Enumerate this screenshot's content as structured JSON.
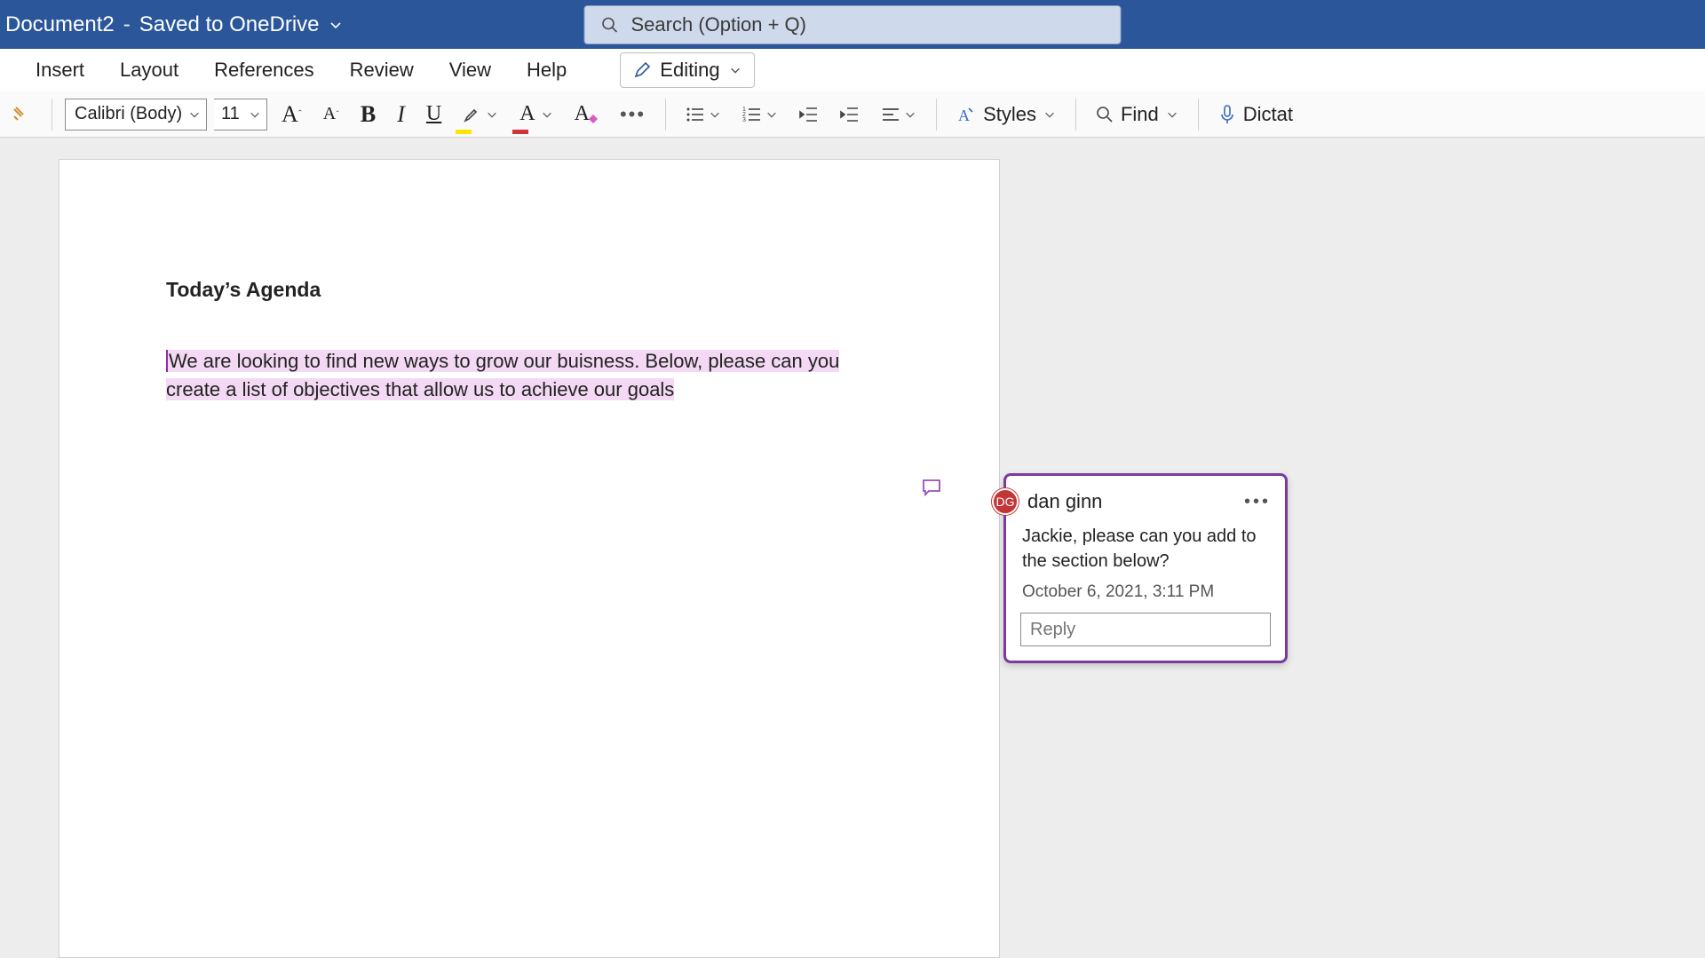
{
  "title": {
    "doc_name": "Document2",
    "save_status": "Saved to OneDrive"
  },
  "search": {
    "placeholder": "Search (Option + Q)"
  },
  "tabs": {
    "insert": "Insert",
    "layout": "Layout",
    "references": "References",
    "review": "Review",
    "view": "View",
    "help": "Help",
    "editing": "Editing"
  },
  "toolbar": {
    "font_name": "Calibri (Body)",
    "font_size": "11",
    "styles": "Styles",
    "find": "Find",
    "dictate": "Dictat"
  },
  "document": {
    "heading": "Today’s Agenda",
    "paragraph": "We are looking to find new ways to grow our buisness. Below, please can you create a list of objectives that allow us to achieve our goals"
  },
  "comment": {
    "initials": "DG",
    "name": "dan ginn",
    "body": "Jackie, please can you add to the section below?",
    "timestamp": "October 6, 2021, 3:11 PM",
    "reply_placeholder": "Reply"
  }
}
